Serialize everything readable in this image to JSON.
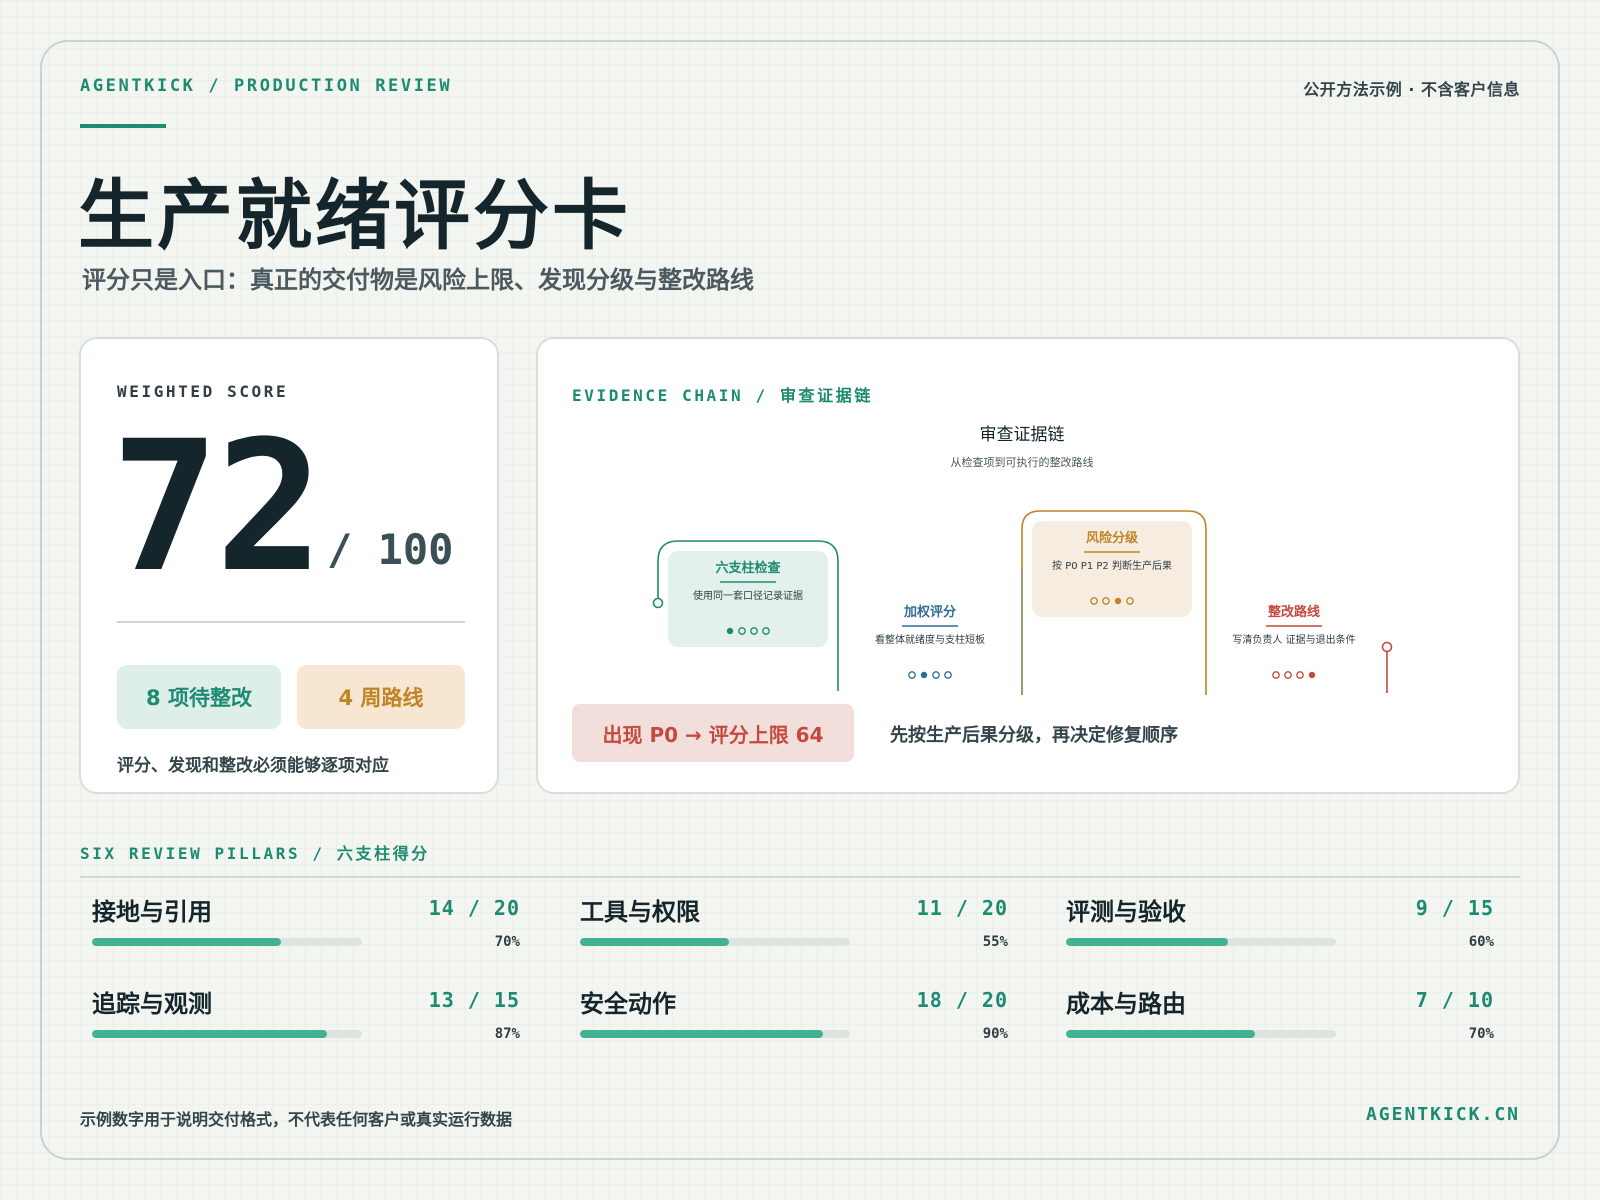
{
  "header": {
    "brand": "AGENTKICK / PRODUCTION REVIEW",
    "disclaimer": "公开方法示例 · 不含客户信息",
    "title": "生产就绪评分卡",
    "subtitle": "评分只是入口：真正的交付物是风险上限、发现分级与整改路线"
  },
  "score_card": {
    "label": "WEIGHTED SCORE",
    "score": "72",
    "max": "/ 100",
    "chip_findings": "8 项待整改",
    "chip_roadmap": "4 周路线",
    "note": "评分、发现和整改必须能够逐项对应"
  },
  "evidence": {
    "label": "EVIDENCE CHAIN / 审查证据链",
    "diagram_title": "审查证据链",
    "diagram_subtitle": "从检查项到可执行的整改路线",
    "steps": [
      {
        "title": "六支柱检查",
        "desc": "使用同一套口径记录证据",
        "color": "#1d8a72",
        "active_dot": 1
      },
      {
        "title": "加权评分",
        "desc": "看整体就绪度与支柱短板",
        "color": "#2f6f95",
        "active_dot": 2
      },
      {
        "title": "风险分级",
        "desc": "按 P0 P1 P2 判断生产后果",
        "color": "#c08426",
        "active_dot": 3
      },
      {
        "title": "整改路线",
        "desc": "写清负责人 证据与退出条件",
        "color": "#c44a3f",
        "active_dot": 4
      }
    ],
    "p0_rule": "出现 P0 → 评分上限 64",
    "p0_note": "先按生产后果分级，再决定修复顺序"
  },
  "pillars": {
    "label": "SIX REVIEW PILLARS / 六支柱得分",
    "items": [
      {
        "name": "接地与引用",
        "score": "14 / 20",
        "pct": "70%",
        "fraction": 0.7
      },
      {
        "name": "工具与权限",
        "score": "11 / 20",
        "pct": "55%",
        "fraction": 0.55
      },
      {
        "name": "评测与验收",
        "score": "9 / 15",
        "pct": "60%",
        "fraction": 0.6
      },
      {
        "name": "追踪与观测",
        "score": "13 / 15",
        "pct": "87%",
        "fraction": 0.87
      },
      {
        "name": "安全动作",
        "score": "18 / 20",
        "pct": "90%",
        "fraction": 0.9
      },
      {
        "name": "成本与路由",
        "score": "7 / 10",
        "pct": "70%",
        "fraction": 0.7
      }
    ]
  },
  "footer": {
    "note": "示例数字用于说明交付格式，不代表任何客户或真实运行数据",
    "site": "AGENTKICK.CN"
  }
}
